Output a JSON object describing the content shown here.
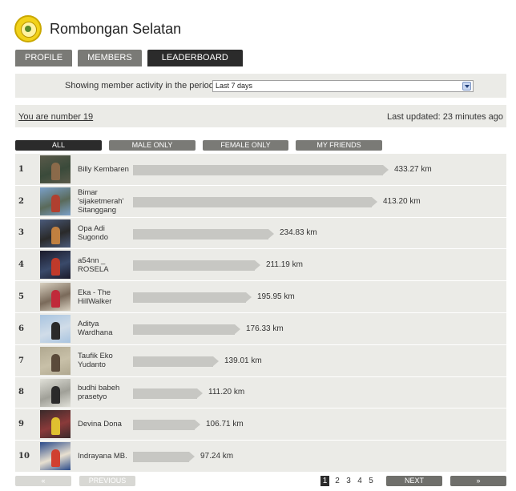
{
  "group": {
    "title": "Rombongan Selatan",
    "logo_icon": "club-logo-icon"
  },
  "tabs": [
    {
      "label": "PROFILE",
      "active": false
    },
    {
      "label": "MEMBERS",
      "active": false
    },
    {
      "label": "LEADERBOARD",
      "active": true
    }
  ],
  "period": {
    "label": "Showing member activity in the period:",
    "selected": "Last 7 days"
  },
  "status": {
    "you_are": "You are number 19",
    "last_updated": "Last updated: 23 minutes ago"
  },
  "filters": [
    {
      "label": "ALL",
      "active": true
    },
    {
      "label": "MALE ONLY",
      "active": false
    },
    {
      "label": "FEMALE ONLY",
      "active": false
    },
    {
      "label": "MY FRIENDS",
      "active": false
    }
  ],
  "leaderboard": [
    {
      "rank": "1",
      "name": "Billy Kembaren",
      "distance": 433.27,
      "distance_label": "433.27 km",
      "avatar_colors": [
        "#5a5a4a",
        "#8a6a4a",
        "#3a4a3a"
      ]
    },
    {
      "rank": "2",
      "name": "Bimar 'sijaketmerah' Sitanggang",
      "distance": 413.2,
      "distance_label": "413.20 km",
      "avatar_colors": [
        "#7aa0c8",
        "#b04030",
        "#5a6a5a"
      ]
    },
    {
      "rank": "3",
      "name": "Opa Adi Sugondo",
      "distance": 234.83,
      "distance_label": "234.83 km",
      "avatar_colors": [
        "#4a5a7a",
        "#c08040",
        "#2a2a2a"
      ]
    },
    {
      "rank": "4",
      "name": "a54nn _ ROSELA",
      "distance": 211.19,
      "distance_label": "211.19 km",
      "avatar_colors": [
        "#1a1a2a",
        "#c03a2a",
        "#3a4a6a"
      ]
    },
    {
      "rank": "5",
      "name": "Eka - The HillWalker",
      "distance": 195.95,
      "distance_label": "195.95 km",
      "avatar_colors": [
        "#d8d0c0",
        "#c02a3a",
        "#7a6a5a"
      ]
    },
    {
      "rank": "6",
      "name": "Aditya Wardhana",
      "distance": 176.33,
      "distance_label": "176.33 km",
      "avatar_colors": [
        "#a8c4e0",
        "#2a2a2a",
        "#d0dce8"
      ]
    },
    {
      "rank": "7",
      "name": "Taufik Eko Yudanto",
      "distance": 139.01,
      "distance_label": "139.01 km",
      "avatar_colors": [
        "#b0a890",
        "#5a4a3a",
        "#c8c0a8"
      ]
    },
    {
      "rank": "8",
      "name": "budhi babeh prasetyo",
      "distance": 111.2,
      "distance_label": "111.20 km",
      "avatar_colors": [
        "#e0e0d8",
        "#2a2a2a",
        "#a0a098"
      ]
    },
    {
      "rank": "9",
      "name": "Devina Dona",
      "distance": 106.71,
      "distance_label": "106.71 km",
      "avatar_colors": [
        "#3a2a2a",
        "#e0c030",
        "#8a3a3a"
      ]
    },
    {
      "rank": "10",
      "name": "Indrayana MB.",
      "distance": 97.24,
      "distance_label": "97.24 km",
      "avatar_colors": [
        "#2a4a8a",
        "#d04030",
        "#e8e0d0"
      ]
    }
  ],
  "pager": {
    "first": "«",
    "previous": "PREVIOUS",
    "pages": [
      "1",
      "2",
      "3",
      "4",
      "5"
    ],
    "current": "1",
    "next": "NEXT",
    "last": "»"
  }
}
